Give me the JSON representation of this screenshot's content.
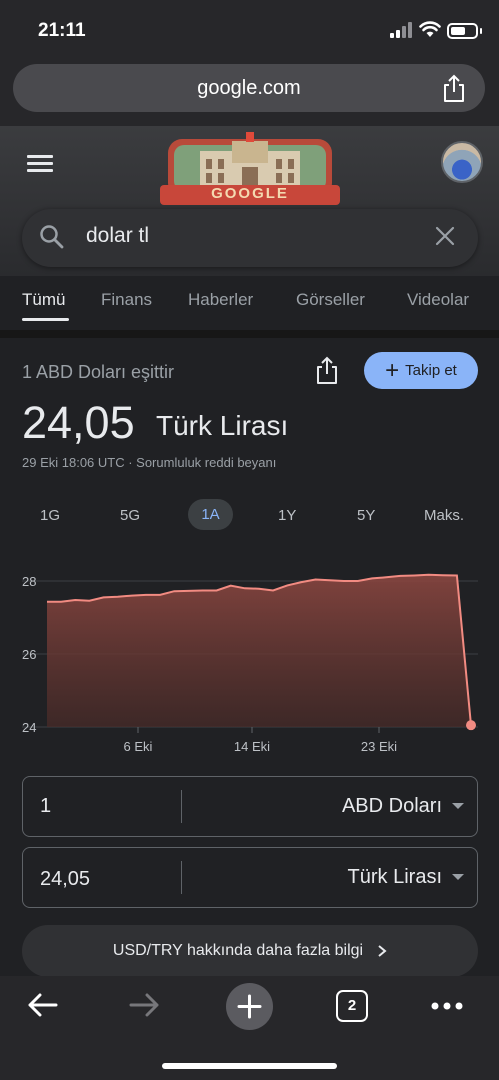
{
  "status_bar": {
    "time": "21:11"
  },
  "browser": {
    "url": "google.com"
  },
  "search": {
    "query": "dolar tl"
  },
  "tabs": [
    {
      "label": "Tümü",
      "active": true
    },
    {
      "label": "Finans"
    },
    {
      "label": "Haberler"
    },
    {
      "label": "Görseller"
    },
    {
      "label": "Videolar"
    }
  ],
  "doodle": {
    "text": "GOOGLE"
  },
  "currency": {
    "equals_label": "1 ABD Doları eşittir",
    "follow_label": "Takip et",
    "value": "24,05",
    "unit": "Türk Lirası",
    "meta": "29 Eki 18:06 UTC · Sorumluluk reddi beyanı"
  },
  "ranges": [
    "1G",
    "5G",
    "1A",
    "1Y",
    "5Y",
    "Maks."
  ],
  "active_range": "1A",
  "chart_data": {
    "type": "area",
    "x_tick_labels": [
      "6 Eki",
      "14 Eki",
      "23 Eki"
    ],
    "y_ticks": [
      24,
      26,
      28
    ],
    "ylim": [
      24,
      28.4
    ],
    "grid": true,
    "series": [
      {
        "values": [
          27.43,
          27.43,
          27.48,
          27.46,
          27.55,
          27.57,
          27.6,
          27.62,
          27.62,
          27.72,
          27.73,
          27.74,
          27.74,
          27.87,
          27.8,
          27.79,
          27.74,
          27.88,
          27.97,
          28.04,
          28.02,
          28.0,
          28.0,
          28.07,
          28.1,
          28.14,
          28.15,
          28.17,
          28.16,
          28.15,
          24.05
        ]
      }
    ],
    "line_color": "#f28b82"
  },
  "converter": {
    "from": {
      "value": "1",
      "unit": "ABD Doları"
    },
    "to": {
      "value": "24,05",
      "unit": "Türk Lirası"
    }
  },
  "more_info": "USD/TRY hakkında daha fazla bilgi",
  "bottom_nav": {
    "tab_count": "2"
  }
}
